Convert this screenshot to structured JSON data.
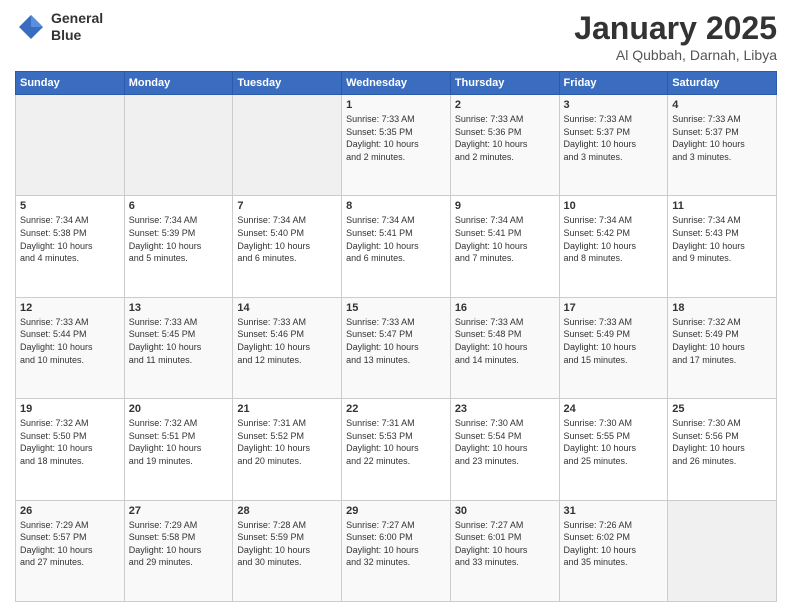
{
  "header": {
    "logo_line1": "General",
    "logo_line2": "Blue",
    "month_title": "January 2025",
    "location": "Al Qubbah, Darnah, Libya"
  },
  "days_of_week": [
    "Sunday",
    "Monday",
    "Tuesday",
    "Wednesday",
    "Thursday",
    "Friday",
    "Saturday"
  ],
  "weeks": [
    [
      {
        "day": "",
        "text": ""
      },
      {
        "day": "",
        "text": ""
      },
      {
        "day": "",
        "text": ""
      },
      {
        "day": "1",
        "text": "Sunrise: 7:33 AM\nSunset: 5:35 PM\nDaylight: 10 hours\nand 2 minutes."
      },
      {
        "day": "2",
        "text": "Sunrise: 7:33 AM\nSunset: 5:36 PM\nDaylight: 10 hours\nand 2 minutes."
      },
      {
        "day": "3",
        "text": "Sunrise: 7:33 AM\nSunset: 5:37 PM\nDaylight: 10 hours\nand 3 minutes."
      },
      {
        "day": "4",
        "text": "Sunrise: 7:33 AM\nSunset: 5:37 PM\nDaylight: 10 hours\nand 3 minutes."
      }
    ],
    [
      {
        "day": "5",
        "text": "Sunrise: 7:34 AM\nSunset: 5:38 PM\nDaylight: 10 hours\nand 4 minutes."
      },
      {
        "day": "6",
        "text": "Sunrise: 7:34 AM\nSunset: 5:39 PM\nDaylight: 10 hours\nand 5 minutes."
      },
      {
        "day": "7",
        "text": "Sunrise: 7:34 AM\nSunset: 5:40 PM\nDaylight: 10 hours\nand 6 minutes."
      },
      {
        "day": "8",
        "text": "Sunrise: 7:34 AM\nSunset: 5:41 PM\nDaylight: 10 hours\nand 6 minutes."
      },
      {
        "day": "9",
        "text": "Sunrise: 7:34 AM\nSunset: 5:41 PM\nDaylight: 10 hours\nand 7 minutes."
      },
      {
        "day": "10",
        "text": "Sunrise: 7:34 AM\nSunset: 5:42 PM\nDaylight: 10 hours\nand 8 minutes."
      },
      {
        "day": "11",
        "text": "Sunrise: 7:34 AM\nSunset: 5:43 PM\nDaylight: 10 hours\nand 9 minutes."
      }
    ],
    [
      {
        "day": "12",
        "text": "Sunrise: 7:33 AM\nSunset: 5:44 PM\nDaylight: 10 hours\nand 10 minutes."
      },
      {
        "day": "13",
        "text": "Sunrise: 7:33 AM\nSunset: 5:45 PM\nDaylight: 10 hours\nand 11 minutes."
      },
      {
        "day": "14",
        "text": "Sunrise: 7:33 AM\nSunset: 5:46 PM\nDaylight: 10 hours\nand 12 minutes."
      },
      {
        "day": "15",
        "text": "Sunrise: 7:33 AM\nSunset: 5:47 PM\nDaylight: 10 hours\nand 13 minutes."
      },
      {
        "day": "16",
        "text": "Sunrise: 7:33 AM\nSunset: 5:48 PM\nDaylight: 10 hours\nand 14 minutes."
      },
      {
        "day": "17",
        "text": "Sunrise: 7:33 AM\nSunset: 5:49 PM\nDaylight: 10 hours\nand 15 minutes."
      },
      {
        "day": "18",
        "text": "Sunrise: 7:32 AM\nSunset: 5:49 PM\nDaylight: 10 hours\nand 17 minutes."
      }
    ],
    [
      {
        "day": "19",
        "text": "Sunrise: 7:32 AM\nSunset: 5:50 PM\nDaylight: 10 hours\nand 18 minutes."
      },
      {
        "day": "20",
        "text": "Sunrise: 7:32 AM\nSunset: 5:51 PM\nDaylight: 10 hours\nand 19 minutes."
      },
      {
        "day": "21",
        "text": "Sunrise: 7:31 AM\nSunset: 5:52 PM\nDaylight: 10 hours\nand 20 minutes."
      },
      {
        "day": "22",
        "text": "Sunrise: 7:31 AM\nSunset: 5:53 PM\nDaylight: 10 hours\nand 22 minutes."
      },
      {
        "day": "23",
        "text": "Sunrise: 7:30 AM\nSunset: 5:54 PM\nDaylight: 10 hours\nand 23 minutes."
      },
      {
        "day": "24",
        "text": "Sunrise: 7:30 AM\nSunset: 5:55 PM\nDaylight: 10 hours\nand 25 minutes."
      },
      {
        "day": "25",
        "text": "Sunrise: 7:30 AM\nSunset: 5:56 PM\nDaylight: 10 hours\nand 26 minutes."
      }
    ],
    [
      {
        "day": "26",
        "text": "Sunrise: 7:29 AM\nSunset: 5:57 PM\nDaylight: 10 hours\nand 27 minutes."
      },
      {
        "day": "27",
        "text": "Sunrise: 7:29 AM\nSunset: 5:58 PM\nDaylight: 10 hours\nand 29 minutes."
      },
      {
        "day": "28",
        "text": "Sunrise: 7:28 AM\nSunset: 5:59 PM\nDaylight: 10 hours\nand 30 minutes."
      },
      {
        "day": "29",
        "text": "Sunrise: 7:27 AM\nSunset: 6:00 PM\nDaylight: 10 hours\nand 32 minutes."
      },
      {
        "day": "30",
        "text": "Sunrise: 7:27 AM\nSunset: 6:01 PM\nDaylight: 10 hours\nand 33 minutes."
      },
      {
        "day": "31",
        "text": "Sunrise: 7:26 AM\nSunset: 6:02 PM\nDaylight: 10 hours\nand 35 minutes."
      },
      {
        "day": "",
        "text": ""
      }
    ]
  ]
}
